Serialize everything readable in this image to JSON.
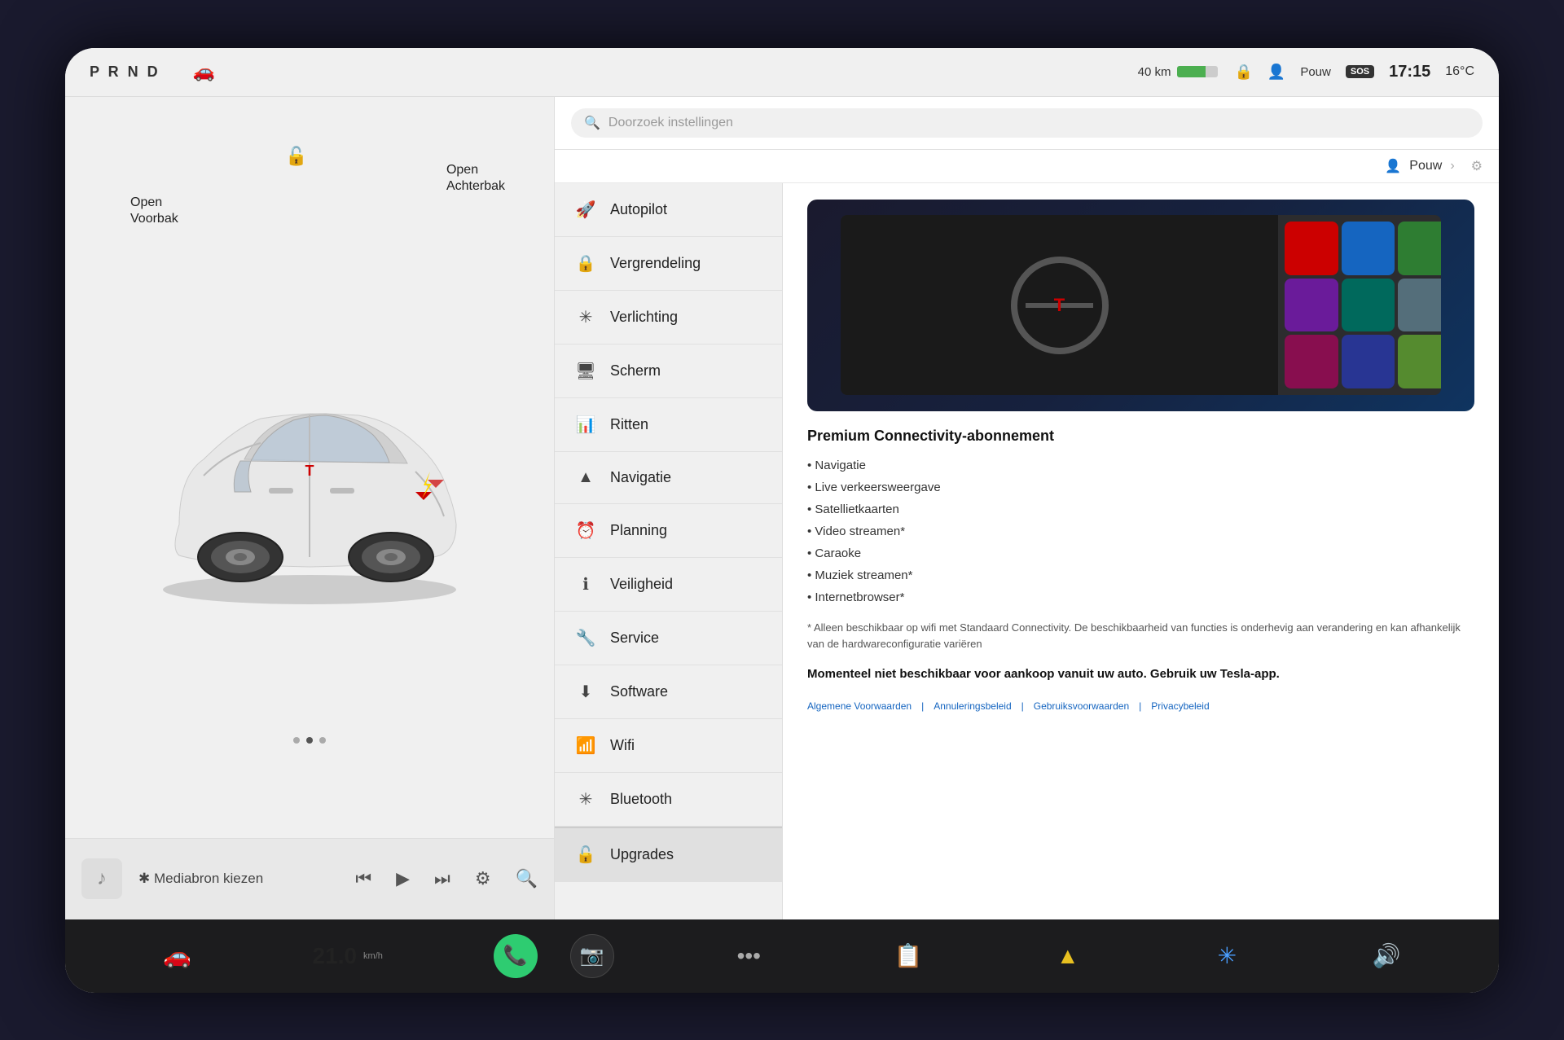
{
  "statusBar": {
    "prnd": "P R N D",
    "seatbeltIcon": "🚗",
    "battery": {
      "km": "40 km",
      "percent": 70
    },
    "lock": "🔒",
    "person": "👤",
    "user": "Pouw",
    "sos": "SOS",
    "time": "17:15",
    "temp": "16°C"
  },
  "leftPanel": {
    "labelFront": "Open\nVoorbak",
    "labelTrunk": "Open\nAchterbak",
    "speedometer": "21.0"
  },
  "mediaBar": {
    "sourceLabel": "✱ Mediabron kiezen"
  },
  "settingsMenu": {
    "searchPlaceholder": "Doorzoek instellingen",
    "profileLabel": "Pouw",
    "items": [
      {
        "id": "autopilot",
        "icon": "🚀",
        "label": "Autopilot"
      },
      {
        "id": "vergrendeling",
        "icon": "🔒",
        "label": "Vergrendeling"
      },
      {
        "id": "verlichting",
        "icon": "💡",
        "label": "Verlichting"
      },
      {
        "id": "scherm",
        "icon": "🖥",
        "label": "Scherm"
      },
      {
        "id": "ritten",
        "icon": "📊",
        "label": "Ritten"
      },
      {
        "id": "navigatie",
        "icon": "▲",
        "label": "Navigatie"
      },
      {
        "id": "planning",
        "icon": "⏰",
        "label": "Planning"
      },
      {
        "id": "veiligheid",
        "icon": "ℹ",
        "label": "Veiligheid"
      },
      {
        "id": "service",
        "icon": "🔧",
        "label": "Service"
      },
      {
        "id": "software",
        "icon": "⬇",
        "label": "Software"
      },
      {
        "id": "wifi",
        "icon": "📶",
        "label": "Wifi"
      },
      {
        "id": "bluetooth",
        "icon": "✳",
        "label": "Bluetooth"
      },
      {
        "id": "upgrades",
        "icon": "🔓",
        "label": "Upgrades",
        "active": true
      }
    ]
  },
  "connectivityPanel": {
    "title": "Premium Connectivity-abonnement",
    "features": [
      "Navigatie",
      "Live verkeersweergave",
      "Satellietkaarten",
      "Video streamen*",
      "Caraoke",
      "Muziek streamen*",
      "Internetbrowser*"
    ],
    "note": "* Alleen beschikbaar op wifi met Standaard Connectivity. De beschikbaarheid van functies is onderhevig aan verandering en kan afhankelijk van de hardwareconfiguratie variëren",
    "cta": "Momenteel niet beschikbaar voor aankoop vanuit uw auto. Gebruik uw Tesla-app.",
    "legalLinks": [
      "Algemene Voorwaarden",
      "Annuleringsbeleid",
      "Gebruiksvoorwaarden",
      "Privacybeleid"
    ]
  },
  "taskbar": {
    "carIcon": "🚗",
    "phoneIcon": "📞",
    "cameraIcon": "📷",
    "dotsIcon": "•••",
    "speedIcon": "📋",
    "navIcon": "▲",
    "bluetoothNavIcon": "✳",
    "volumeIcon": "🔊"
  }
}
